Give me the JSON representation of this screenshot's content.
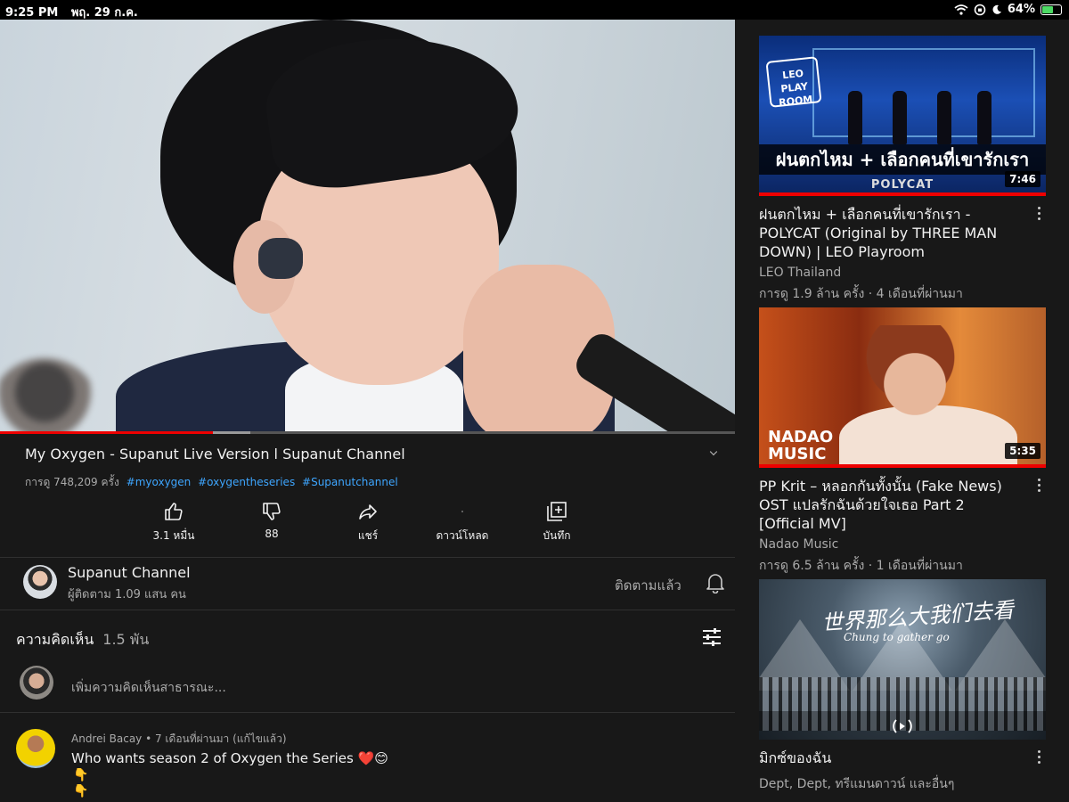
{
  "status_bar": {
    "time": "9:25 PM",
    "date": "พฤ. 29 ก.ค.",
    "battery": "64%",
    "battery_level": 0.64,
    "icons": [
      "wifi-icon",
      "orientation-lock-icon",
      "moon-icon",
      "battery-charging-icon"
    ]
  },
  "player": {
    "progress": 0.29,
    "buffered": 0.34
  },
  "video": {
    "title": "My Oxygen - Supanut Live Version l Supanut Channel",
    "views": "การดู 748,209 ครั้ง",
    "hashtags": [
      "#myoxygen",
      "#oxygentheseries",
      "#Supanutchannel"
    ]
  },
  "actions": {
    "like": "3.1 หมื่น",
    "dislike": "88",
    "share": "แชร์",
    "download": "ดาวน์โหลด",
    "save": "บันทึก"
  },
  "channel": {
    "name": "Supanut Channel",
    "subscribers": "ผู้ติดตาม 1.09 แสน คน",
    "subscribe_state": "ติดตามแล้ว"
  },
  "comments": {
    "heading": "ความคิดเห็น",
    "count": "1.5 พัน",
    "placeholder": "เพิ่มความคิดเห็นสาธารณะ...",
    "items": [
      {
        "author": "Andrei Bacay • 7 เดือนที่ผ่านมา (แก้ไขแล้ว)",
        "text": "Who wants season 2 of Oxygen the Series ❤️😊",
        "emoji_line_1": "👇",
        "emoji_line_2": "👇"
      }
    ]
  },
  "sidebar": {
    "items": [
      {
        "title": "ฝนตกไหม + เลือกคนที่เขารักเรา - POLYCAT (Original by THREE MAN DOWN) | LEO Playroom",
        "channel": "LEO Thailand",
        "meta": "การดู 1.9 ล้าน ครั้ง · 4 เดือนที่ผ่านมา",
        "duration": "7:46",
        "thumb_logo_line1": "LEO",
        "thumb_logo_line2": "PLAY",
        "thumb_logo_line3": "ROOM",
        "thumb_caption": "ฝนตกไหม + เลือกคนที่เขารักเรา",
        "thumb_brand": "POLYCAT"
      },
      {
        "title": "PP Krit – หลอกกันทั้งนั้น (Fake News) OST แปลรักฉันด้วยใจเธอ Part 2 [Official MV]",
        "channel": "Nadao Music",
        "meta": "การดู 6.5 ล้าน ครั้ง · 1 เดือนที่ผ่านมา",
        "duration": "5:35",
        "thumb_logo_line1": "NADAO",
        "thumb_logo_line2": "MUSIC"
      },
      {
        "title": "มิกซ์ของฉัน",
        "channel": "Dept, Dept, ทรีแมนดาวน์ และอื่นๆ",
        "thumb_title": "世界那么大我们去看",
        "thumb_sub": "Chung to gather go"
      }
    ]
  }
}
